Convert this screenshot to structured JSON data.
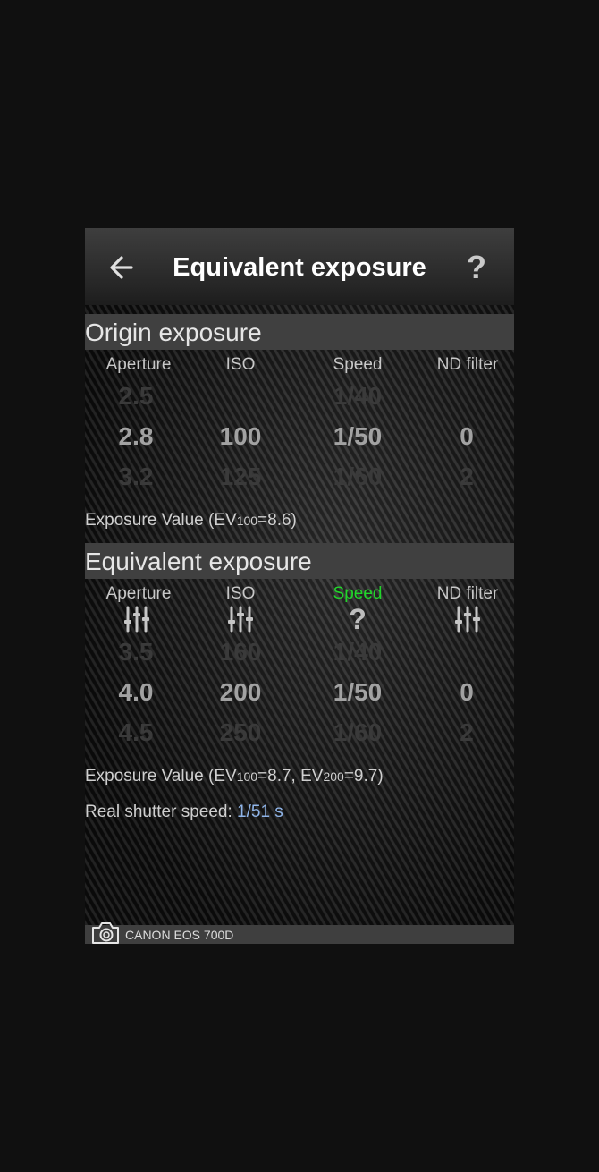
{
  "header": {
    "title": "Equivalent exposure",
    "back_icon": "arrow-left-icon",
    "help_icon": "question-icon",
    "help_label": "?"
  },
  "origin": {
    "heading": "Origin exposure",
    "columns": {
      "aperture": {
        "label": "Aperture",
        "prev": "2.5",
        "value": "2.8",
        "next": "3.2"
      },
      "iso": {
        "label": "ISO",
        "prev": "",
        "value": "100",
        "next": "125"
      },
      "speed": {
        "label": "Speed",
        "prev": "1/40",
        "value": "1/50",
        "next": "1/60"
      },
      "nd": {
        "label": "ND filter",
        "prev": "",
        "value": "0",
        "next": "2"
      }
    },
    "ev_prefix": "Exposure Value (EV",
    "ev_sub": "100",
    "ev_suffix": "=8.6)"
  },
  "equivalent": {
    "heading": "Equivalent exposure",
    "columns": {
      "aperture": {
        "label": "Aperture",
        "icon": "sliders-icon",
        "prev": "3.5",
        "value": "4.0",
        "next": "4.5"
      },
      "iso": {
        "label": "ISO",
        "icon": "sliders-icon",
        "prev": "160",
        "value": "200",
        "next": "250"
      },
      "speed": {
        "label": "Speed",
        "icon": "question-icon",
        "icon_label": "?",
        "prev": "1/40",
        "value": "1/50",
        "next": "1/60"
      },
      "nd": {
        "label": "ND filter",
        "icon": "sliders-icon",
        "prev": "",
        "value": "0",
        "next": "2"
      }
    },
    "ev_prefix": "Exposure Value (EV",
    "ev_sub1": "100",
    "ev_mid": "=8.7, EV",
    "ev_sub2": "200",
    "ev_suffix": "=9.7)",
    "shutter_label": "Real shutter speed: ",
    "shutter_value": "1/51 s"
  },
  "footer": {
    "camera_icon": "camera-icon",
    "camera_name": "CANON EOS 700D"
  },
  "colors": {
    "active_column": "#21d52a",
    "accent_value": "#8fb4e8",
    "section_header_bg": "#404040",
    "page_bg": "#101010"
  }
}
